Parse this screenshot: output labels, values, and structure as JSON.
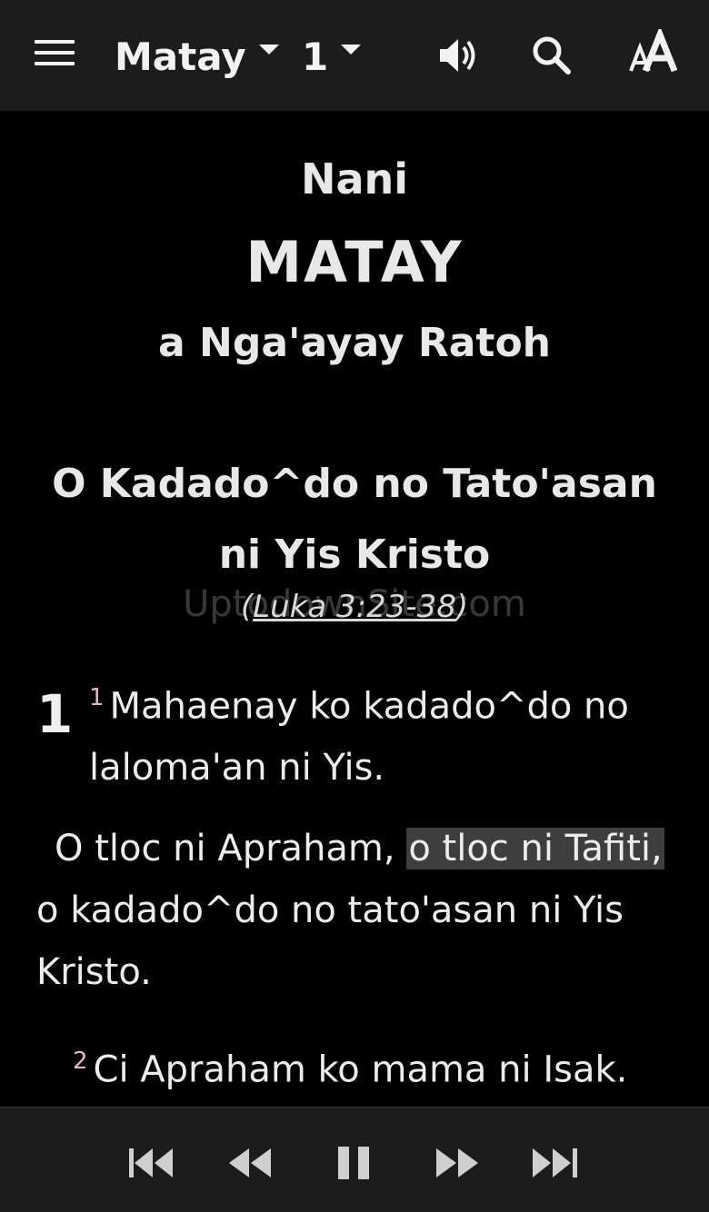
{
  "header": {
    "book": "Matay",
    "chapter": "1"
  },
  "content": {
    "heading_small": "Nani",
    "heading_big": "MATAY",
    "heading_sub": "a Nga'ayay Ratoh",
    "section_title": "O Kadado^do no Tato'asan ni Yis Kristo",
    "reference_open": "(",
    "reference_link": "Luka 3:23-38",
    "reference_close": ")",
    "watermark": "UptodownSite.com",
    "chapter_number": "1",
    "verse1_num": "1",
    "verse1_text": "Mahaenay ko kadado^do no laloma'an ni Yis.",
    "para2_before": "O tloc ni Apraham, ",
    "para2_highlight": "o tloc ni Tafiti,",
    "para2_after": " o kadado^do no tato'asan ni Yis Kristo.",
    "verse2_num": "2",
    "verse2_text": "Ci Apraham ko mama ni Isak."
  },
  "colors": {
    "background": "#000000",
    "bar": "#1c1c1c",
    "verse_number": "#e8b4c0",
    "highlight": "#3e3e3e"
  },
  "icons": {
    "menu": "hamburger-icon",
    "audio": "speaker-icon",
    "search": "search-icon",
    "text_size": "font-size-icon",
    "first": "skip-first-icon",
    "previous": "rewind-icon",
    "pause": "pause-icon",
    "next": "fast-forward-icon",
    "last": "skip-last-icon"
  }
}
